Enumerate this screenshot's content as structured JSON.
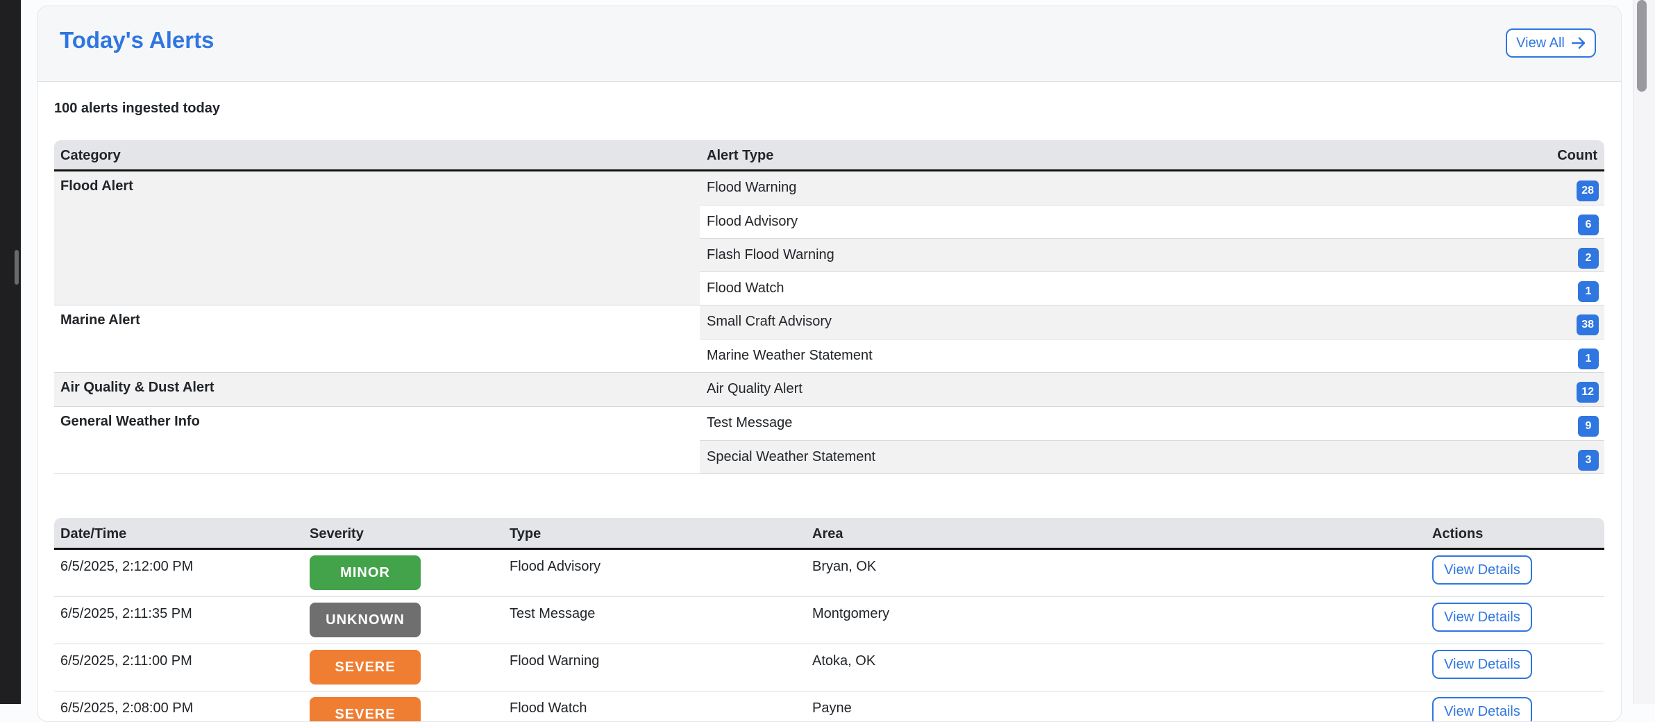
{
  "header": {
    "title": "Today's Alerts",
    "view_all_label": "View All",
    "view_all_icon": "arrow-right-icon"
  },
  "summary_text": "100 alerts ingested today",
  "summary_table": {
    "columns": [
      "Category",
      "Alert Type",
      "Count"
    ],
    "groups": [
      {
        "category": "Flood Alert",
        "rows": [
          {
            "type": "Flood Warning",
            "count": "28"
          },
          {
            "type": "Flood Advisory",
            "count": "6"
          },
          {
            "type": "Flash Flood Warning",
            "count": "2"
          },
          {
            "type": "Flood Watch",
            "count": "1"
          }
        ]
      },
      {
        "category": "Marine Alert",
        "rows": [
          {
            "type": "Small Craft Advisory",
            "count": "38"
          },
          {
            "type": "Marine Weather Statement",
            "count": "1"
          }
        ]
      },
      {
        "category": "Air Quality & Dust Alert",
        "rows": [
          {
            "type": "Air Quality Alert",
            "count": "12"
          }
        ]
      },
      {
        "category": "General Weather Info",
        "rows": [
          {
            "type": "Test Message",
            "count": "9"
          },
          {
            "type": "Special Weather Statement",
            "count": "3"
          }
        ]
      }
    ]
  },
  "alerts_table": {
    "columns": [
      "Date/Time",
      "Severity",
      "Type",
      "Area",
      "Actions"
    ],
    "rows": [
      {
        "datetime": "6/5/2025, 2:12:00 PM",
        "severity": "MINOR",
        "type": "Flood Advisory",
        "area": "Bryan, OK",
        "action": "View Details"
      },
      {
        "datetime": "6/5/2025, 2:11:35 PM",
        "severity": "UNKNOWN",
        "type": "Test Message",
        "area": "Montgomery",
        "action": "View Details"
      },
      {
        "datetime": "6/5/2025, 2:11:00 PM",
        "severity": "SEVERE",
        "type": "Flood Warning",
        "area": "Atoka, OK",
        "action": "View Details"
      },
      {
        "datetime": "6/5/2025, 2:08:00 PM",
        "severity": "SEVERE",
        "type": "Flood Watch",
        "area": "Payne",
        "action": "View Details"
      }
    ]
  },
  "colors": {
    "accent": "#2f76e0",
    "severity": {
      "MINOR": "#43a34a",
      "UNKNOWN": "#6f6f6f",
      "SEVERE": "#ef7d32"
    }
  }
}
